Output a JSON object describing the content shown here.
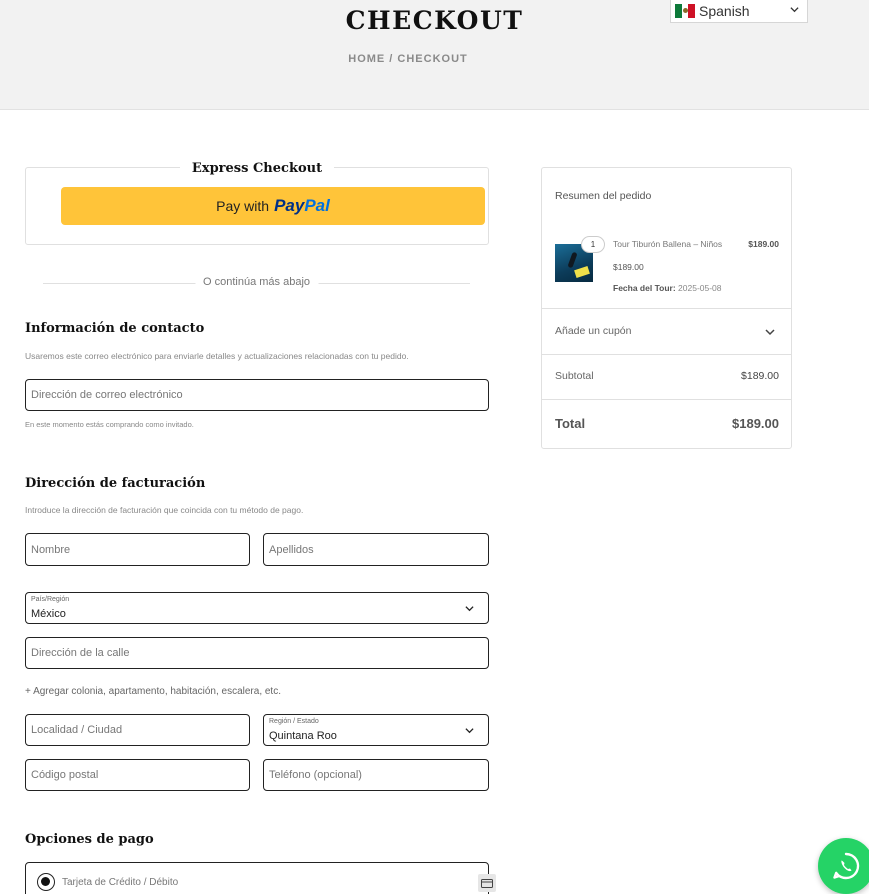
{
  "header": {
    "title": "CHECKOUT",
    "breadcrumb": "HOME / CHECKOUT"
  },
  "language": {
    "selected": "Spanish",
    "flag_icon": "mexico-flag-icon"
  },
  "express_checkout": {
    "title": "Express Checkout",
    "pay_prefix": "Pay with",
    "paypal_pay": "Pay",
    "paypal_pal": "Pal",
    "button_color": "#ffc439"
  },
  "divider_text": "O continúa más abajo",
  "contact": {
    "heading": "Información de contacto",
    "help": "Usaremos este correo electrónico para enviarle detalles y actualizaciones relacionadas con tu pedido.",
    "email_placeholder": "Dirección de correo electrónico",
    "email_note": "En este momento estás comprando como invitado."
  },
  "billing": {
    "heading": "Dirección de facturación",
    "help": "Introduce la dirección de facturación que coincida con tu método de pago.",
    "first_name_placeholder": "Nombre",
    "last_name_placeholder": "Apellidos",
    "country_label": "País/Región",
    "country_value": "México",
    "street_placeholder": "Dirección de la calle",
    "add_more": "+ Agregar colonia, apartamento, habitación, escalera, etc.",
    "city_placeholder": "Localidad / Ciudad",
    "state_label": "Región / Estado",
    "state_value": "Quintana Roo",
    "postcode_placeholder": "Código postal",
    "phone_placeholder": "Teléfono (opcional)"
  },
  "payment": {
    "heading": "Opciones de pago",
    "method_label": "Tarjeta de Crédito / Débito"
  },
  "summary": {
    "title": "Resumen del pedido",
    "item": {
      "quantity": "1",
      "name": "Tour Tiburón Ballena – Niños",
      "line_total": "$189.00",
      "unit_price": "$189.00",
      "meta_label": "Fecha del Tour:",
      "meta_value": "2025-05-08"
    },
    "coupon_label": "Añade un cupón",
    "subtotal_label": "Subtotal",
    "subtotal_value": "$189.00",
    "total_label": "Total",
    "total_value": "$189.00"
  },
  "whatsapp": {
    "icon": "whatsapp-icon",
    "color": "#25d366"
  }
}
